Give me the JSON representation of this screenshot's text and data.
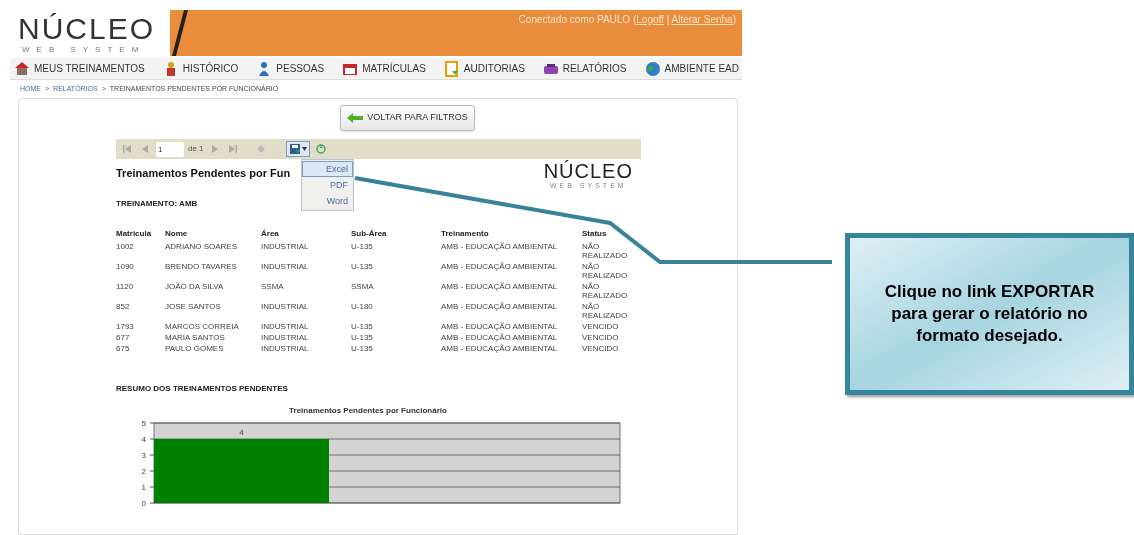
{
  "header": {
    "logo": "NÚCLEO",
    "logo_subtitle": "WEB SYSTEM",
    "session": {
      "prefix": "Conectado como PAULO (",
      "links": [
        "Logoff",
        "Alterar Senha"
      ],
      "separator": "|",
      "suffix": ")"
    }
  },
  "nav": [
    {
      "label": "MEUS TREINAMENTOS"
    },
    {
      "label": "HISTÓRICO"
    },
    {
      "label": "PESSOAS"
    },
    {
      "label": "MATRÍCULAS"
    },
    {
      "label": "AUDITORIAS"
    },
    {
      "label": "RELATÓRIOS"
    },
    {
      "label": "AMBIENTE EAD"
    }
  ],
  "breadcrumb": {
    "separator": ">",
    "items": [
      "HOME",
      "RELATÓRIOS",
      "TREINAMENTOS PENDENTES POR FUNCIONÁRIO"
    ]
  },
  "back_button": "VOLTAR PARA FILTROS",
  "toolbar": {
    "page": "1",
    "of": "de 1"
  },
  "export_menu": {
    "expanded": true,
    "items": [
      {
        "label": "Excel",
        "selected": true
      },
      {
        "label": "PDF",
        "selected": false
      },
      {
        "label": "Word",
        "selected": false
      }
    ]
  },
  "report": {
    "title": "Treinamentos Pendentes por Fun",
    "logo": "NÚCLEO",
    "logo_subtitle": "WEB SYSTEM",
    "group": "TREINAMENTO: AMB",
    "columns": [
      "Matricula",
      "Nome",
      "Área",
      "Sub-Área",
      "Treinamento",
      "Status"
    ],
    "rows": [
      [
        "1002",
        "ADRIANO SOARES",
        "INDUSTRIAL",
        "U-135",
        "AMB - EDUCAÇÃO AMBIENTAL",
        "NÃO REALIZADO"
      ],
      [
        "1090",
        "BRENDO TAVARES",
        "INDUSTRIAL",
        "U-135",
        "AMB - EDUCAÇÃO AMBIENTAL",
        "NÃO REALIZADO"
      ],
      [
        "1120",
        "JOÃO DA SILVA",
        "SSMA",
        "SSMA",
        "AMB - EDUCAÇÃO AMBIENTAL",
        "NÃO REALIZADO"
      ],
      [
        "852",
        "JOSE SANTOS",
        "INDUSTRIAL",
        "U-180",
        "AMB - EDUCAÇÃO AMBIENTAL",
        "NÃO REALIZADO"
      ],
      [
        "1793",
        "MARCOS CORREIA",
        "INDUSTRIAL",
        "U-135",
        "AMB - EDUCAÇÃO AMBIENTAL",
        "VENCIDO"
      ],
      [
        "677",
        "MARIA SANTOS",
        "INDUSTRIAL",
        "U-135",
        "AMB - EDUCAÇÃO AMBIENTAL",
        "VENCIDO"
      ],
      [
        "675",
        "PAULO GOMES",
        "INDUSTRIAL",
        "U-135",
        "AMB - EDUCAÇÃO AMBIENTAL",
        "VENCIDO"
      ]
    ],
    "summary_title": "RESUMO DOS TREINAMENTOS PENDENTES",
    "chart_data": {
      "type": "bar",
      "title": "Treinamentos Pendentes por Funcionário",
      "values": [
        4
      ],
      "ylim": [
        0,
        5
      ],
      "yticks": [
        0,
        1,
        2,
        3,
        4,
        5
      ],
      "data_labels": true,
      "grid": true
    }
  },
  "callout": "Clique no link EXPORTAR para gerar o relatório no formato desejado."
}
